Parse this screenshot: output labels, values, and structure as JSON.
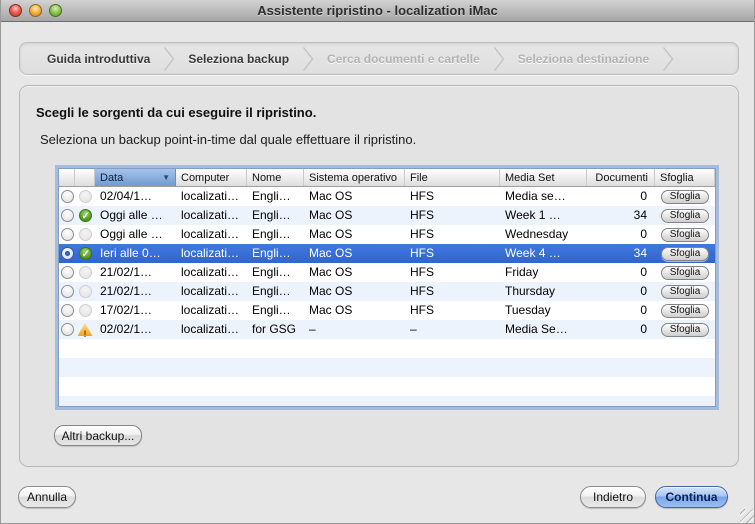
{
  "titlebar": {
    "title": "Assistente ripristino - localization iMac"
  },
  "breadcrumb": {
    "steps": [
      {
        "label": "Guida introduttiva",
        "state": "active"
      },
      {
        "label": "Seleziona backup",
        "state": "active"
      },
      {
        "label": "Cerca documenti e cartelle",
        "state": "inactive"
      },
      {
        "label": "Seleziona destinazione",
        "state": "inactive"
      }
    ]
  },
  "main": {
    "heading": "Scegli le sorgenti da cui eseguire il ripristino.",
    "subheading": "Seleziona un backup point-in-time dal quale effettuare il ripristino.",
    "altri_backup_label": "Altri backup..."
  },
  "table": {
    "sort_indicator": "▼",
    "browse_button_label": "Sfoglia",
    "columns": [
      {
        "key": "radio",
        "label": ""
      },
      {
        "key": "status",
        "label": ""
      },
      {
        "key": "data",
        "label": "Data",
        "sorted": true
      },
      {
        "key": "computer",
        "label": "Computer"
      },
      {
        "key": "nome",
        "label": "Nome"
      },
      {
        "key": "so",
        "label": "Sistema operativo"
      },
      {
        "key": "file",
        "label": "File"
      },
      {
        "key": "media",
        "label": "Media Set"
      },
      {
        "key": "documenti",
        "label": "Documenti",
        "numeric": true
      },
      {
        "key": "sfoglia",
        "label": "Sfoglia"
      }
    ],
    "rows": [
      {
        "selected": false,
        "status": "none",
        "data": "02/04/1…",
        "computer": "localizati…",
        "nome": "Engli…",
        "so": "Mac OS",
        "file": "HFS",
        "media": "Media se…",
        "documenti": "0"
      },
      {
        "selected": false,
        "status": "ok",
        "data": "Oggi alle …",
        "computer": "localizati…",
        "nome": "Engli…",
        "so": "Mac OS",
        "file": "HFS",
        "media": "Week 1 …",
        "documenti": "34"
      },
      {
        "selected": false,
        "status": "none",
        "data": "Oggi alle …",
        "computer": "localizati…",
        "nome": "Engli…",
        "so": "Mac OS",
        "file": "HFS",
        "media": "Wednesday",
        "documenti": "0"
      },
      {
        "selected": true,
        "status": "ok",
        "data": "Ieri alle 0…",
        "computer": "localizati…",
        "nome": "Engli…",
        "so": "Mac OS",
        "file": "HFS",
        "media": "Week 4 …",
        "documenti": "34"
      },
      {
        "selected": false,
        "status": "none",
        "data": "21/02/1…",
        "computer": "localizati…",
        "nome": "Engli…",
        "so": "Mac OS",
        "file": "HFS",
        "media": "Friday",
        "documenti": "0"
      },
      {
        "selected": false,
        "status": "none",
        "data": "21/02/1…",
        "computer": "localizati…",
        "nome": "Engli…",
        "so": "Mac OS",
        "file": "HFS",
        "media": "Thursday",
        "documenti": "0"
      },
      {
        "selected": false,
        "status": "none",
        "data": "17/02/1…",
        "computer": "localizati…",
        "nome": "Engli…",
        "so": "Mac OS",
        "file": "HFS",
        "media": "Tuesday",
        "documenti": "0"
      },
      {
        "selected": false,
        "status": "warning",
        "data": "02/02/1…",
        "computer": "localizati…",
        "nome": "for GSG",
        "so": "–",
        "file": "–",
        "media": "Media Se…",
        "documenti": "0"
      }
    ]
  },
  "footer": {
    "annulla": "Annulla",
    "indietro": "Indietro",
    "continua": "Continua"
  },
  "colors": {
    "selection_blue": "#3570d6",
    "sorted_header_blue": "#8cb0de",
    "row_stripe_blue": "#edf3fd",
    "continua_blue": "#9dc0f2",
    "ok_green": "#55a024",
    "warning_yellow": "#f2a51e",
    "titlebar_gray": "#b9b9b9"
  }
}
